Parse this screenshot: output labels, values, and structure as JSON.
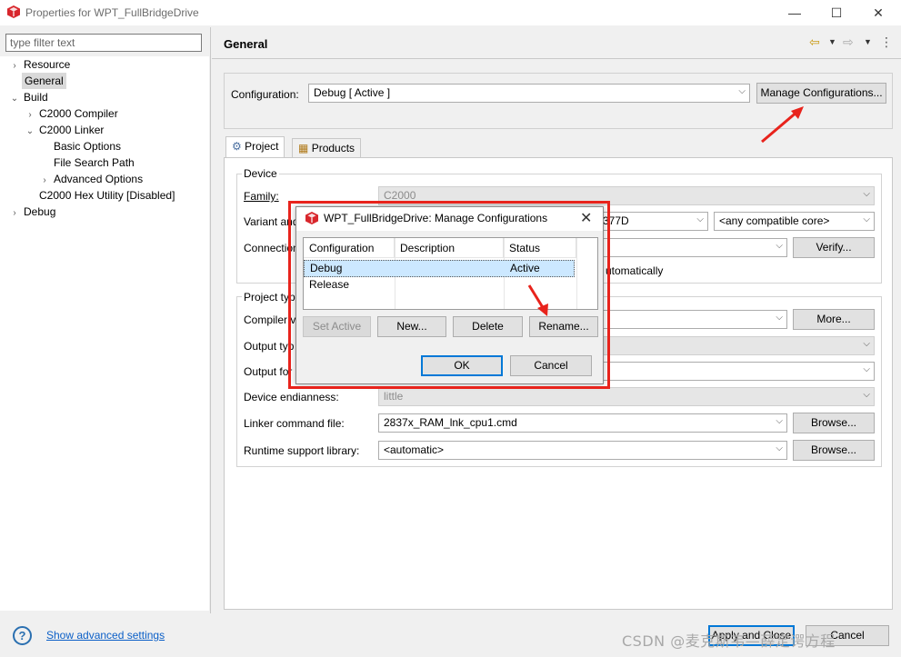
{
  "window": {
    "title": "Properties for WPT_FullBridgeDrive",
    "minimize_icon": "minimize-icon",
    "maximize_icon": "maximize-icon",
    "close_icon": "close-icon"
  },
  "sidebar": {
    "filter_placeholder": "type filter text",
    "items": [
      {
        "label": "Resource",
        "twisty": "›"
      },
      {
        "label": "General",
        "selected": true
      },
      {
        "label": "Build",
        "twisty": "⌄"
      },
      {
        "label": "C2000 Compiler",
        "twisty": "›"
      },
      {
        "label": "C2000 Linker",
        "twisty": "⌄"
      },
      {
        "label": "Basic Options"
      },
      {
        "label": "File Search Path"
      },
      {
        "label": "Advanced Options",
        "twisty": "›"
      },
      {
        "label": "C2000 Hex Utility  [Disabled]"
      },
      {
        "label": "Debug",
        "twisty": "›"
      }
    ]
  },
  "main": {
    "title": "General",
    "configuration_label": "Configuration:",
    "configuration_value": "Debug  [ Active ]",
    "manage_button": "Manage Configurations...",
    "tabs": [
      {
        "label": "Project",
        "active": true
      },
      {
        "label": "Products"
      }
    ],
    "device_group": "Device",
    "family_label": "Family:",
    "family_value": "C2000",
    "variant_label": "Variant and",
    "variant_value_visible": "377D",
    "core_value": "<any compatible core>",
    "connection_label": "Connection",
    "verify_button": "Verify...",
    "auto_text": "utomatically",
    "project_group": "Project typ",
    "compiler_label": "Compiler v",
    "more_button": "More...",
    "output_type_label": "Output typ",
    "output_format_label": "Output for",
    "endianness_label": "Device endianness:",
    "endianness_value": "little",
    "linker_label": "Linker command file:",
    "linker_value": "2837x_RAM_lnk_cpu1.cmd",
    "browse_button_1": "Browse...",
    "runtime_label": "Runtime support library:",
    "runtime_value": "<automatic>",
    "browse_button_2": "Browse..."
  },
  "footer": {
    "help_icon": "?",
    "advanced_link": "Show advanced settings",
    "apply_close": "Apply and Close",
    "cancel": "Cancel",
    "watermark": "CSDN @麦克斯韦—薛定谔方程"
  },
  "dialog": {
    "title": "WPT_FullBridgeDrive: Manage Configurations",
    "columns": [
      "Configuration",
      "Description",
      "Status"
    ],
    "rows": [
      {
        "configuration": "Debug",
        "description": "",
        "status": "Active",
        "selected": true
      },
      {
        "configuration": "Release",
        "description": "",
        "status": ""
      }
    ],
    "set_active": "Set Active",
    "new": "New...",
    "delete": "Delete",
    "rename": "Rename...",
    "ok": "OK",
    "cancel": "Cancel"
  },
  "colors": {
    "annotation_red": "#e8231c",
    "link_blue": "#0b5fc7",
    "selection_blue": "#cce8ff"
  }
}
